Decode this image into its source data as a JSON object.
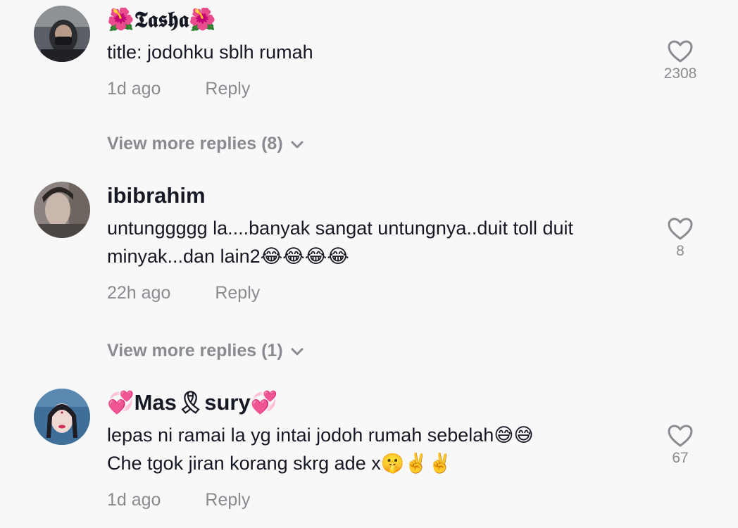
{
  "comments": [
    {
      "username": "🌺𝕿𝖆𝖘𝖍𝖆🌺",
      "text_lines": [
        "title: jodohku sblh rumah"
      ],
      "time": "1d ago",
      "reply_label": "Reply",
      "likes": "2308",
      "view_more": "View more replies (8)"
    },
    {
      "username": "ibibrahim",
      "text_lines": [
        "untunggggg la....banyak sangat untungnya..duit toll duit",
        "minyak...dan lain2😂😂😂😂"
      ],
      "time": "22h ago",
      "reply_label": "Reply",
      "likes": "8",
      "view_more": "View more replies (1)"
    },
    {
      "username": "💞Mas🎗sury💞",
      "text_lines": [
        "lepas ni ramai la yg intai jodoh rumah sebelah😅😅",
        "Che tgok jiran korang skrg ade x🤫✌️✌️"
      ],
      "time": "1d ago",
      "reply_label": "Reply",
      "likes": "67"
    }
  ],
  "icons": {
    "like": "heart-outline-icon",
    "expand": "chevron-down-icon"
  },
  "colors": {
    "background": "#f8f8f8",
    "primary_text": "#161823",
    "secondary_text": "#8a8b91"
  }
}
